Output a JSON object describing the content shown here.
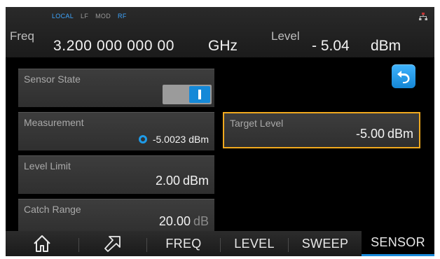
{
  "header": {
    "indicators": [
      {
        "label": "LOCAL",
        "active": true
      },
      {
        "label": "LF",
        "active": false
      },
      {
        "label": "MOD",
        "active": false
      },
      {
        "label": "RF",
        "active": true
      }
    ],
    "freq_label": "Freq",
    "freq_value": "3.200 000 000 00",
    "freq_unit": "GHz",
    "level_label": "Level",
    "level_value": "- 5.04",
    "level_unit": "dBm",
    "network_icon": "network-icon"
  },
  "panels": {
    "sensor_state": {
      "label": "Sensor State",
      "state": "on"
    },
    "measurement": {
      "label": "Measurement",
      "value": "-5.0023 dBm"
    },
    "target_level": {
      "label": "Target Level",
      "value": "-5.00",
      "unit": "dBm"
    },
    "level_limit": {
      "label": "Level Limit",
      "value": "2.00",
      "unit": "dBm"
    },
    "catch_range": {
      "label": "Catch Range",
      "value": "20.00",
      "unit": "dB"
    }
  },
  "back_icon": "back-arrow-icon",
  "nav": {
    "home_icon": "home-icon",
    "arrow_icon": "arrow-icon",
    "items": [
      "FREQ",
      "LEVEL",
      "SWEEP",
      "SENSOR"
    ],
    "active": "SENSOR"
  },
  "colors": {
    "accent": "#1589d8",
    "highlight": "#f0a91e",
    "indicator_active": "#3ea6ff"
  }
}
